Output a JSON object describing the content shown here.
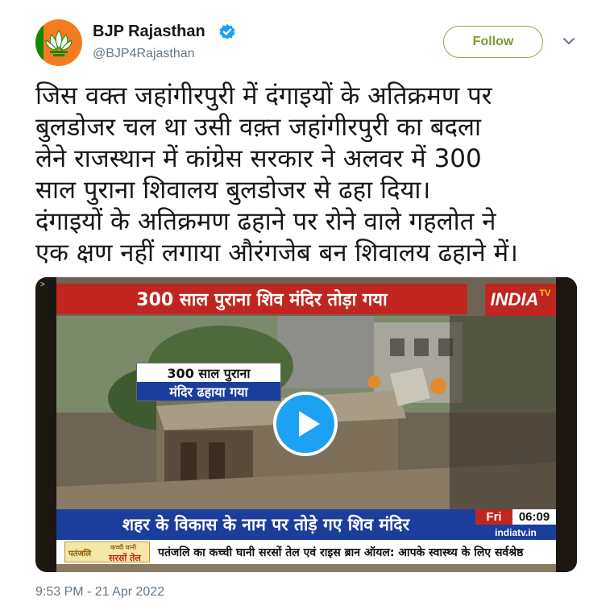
{
  "author": {
    "name": "BJP Rajasthan",
    "handle": "@BJP4Rajasthan",
    "verified": true,
    "avatar_icon": "lotus-icon"
  },
  "follow_button": {
    "label": "Follow"
  },
  "menu_icon": "chevron-down-icon",
  "tweet": {
    "lines": [
      "जिस वक्त जहांगीरपुरी में दंगाइयों के अतिक्रमण पर",
      "बुलडोजर चल था उसी वक़्त जहांगीरपुरी का बदला",
      "लेने राजस्थान में कांग्रेस सरकार ने अलवर में 300",
      "साल पुराना शिवालय बुलडोजर से ढहा दिया।",
      "दंगाइयों के अतिक्रमण ढहाने पर रोने वाले गहलोत ने",
      "एक क्षण नहीं लगाया औरंगजेब बन शिवालय ढहाने में।"
    ],
    "timestamp": "9:53 PM - 21 Apr 2022"
  },
  "video": {
    "corner_mark": ">",
    "top_banner": "300 साल पुराना शिव मंदिर तोड़ा गया",
    "logo": "INDIA",
    "logo_suffix": "TV",
    "caption_line1": "300 साल पुराना",
    "caption_line2": "मंदिर ढहाया गया",
    "bottom_banner": "शहर के विकास के नाम पर तोड़े गए शिव मंदिर",
    "day": "Fri",
    "time": "06:09",
    "site": "indiatv.in",
    "ad_brand": "पतंजलि",
    "ad_product": "कच्ची घानी",
    "ad_oil": "सरसों तेल",
    "ticker": "पतंजलि का कच्ची घानी सरसों तेल एवं राइस ब्रान ऑयल: आपके स्वास्थ्य के लिए सर्वश्रेष्ठ",
    "play_icon": "play-icon"
  },
  "colors": {
    "follow": "#7d9a2c",
    "play": "#1da1f2",
    "red_banner": "#c0261f",
    "blue_banner": "#1b3d9c",
    "handle": "#657786"
  }
}
